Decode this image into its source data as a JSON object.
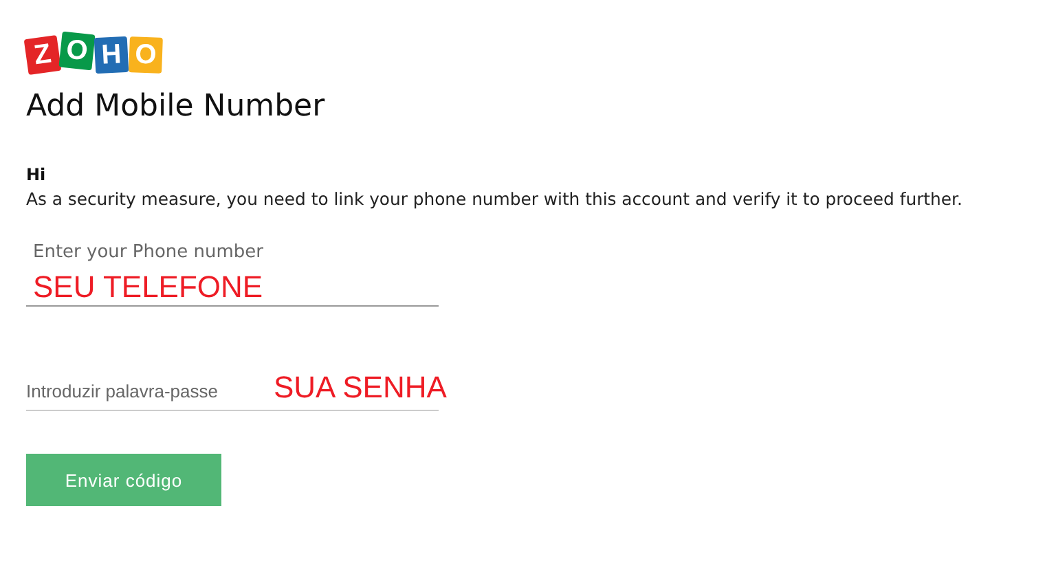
{
  "logo": {
    "letters": [
      {
        "char": "Z",
        "color": "#e42527"
      },
      {
        "char": "O",
        "color": "#089949"
      },
      {
        "char": "H",
        "color": "#226db4"
      },
      {
        "char": "O",
        "color": "#f9b21d"
      }
    ]
  },
  "title": "Add Mobile Number",
  "greeting": "Hi",
  "message": "As a security measure, you need to link your phone number with this account and verify it to proceed further.",
  "phone_field": {
    "label": "Enter your Phone number",
    "value": "SEU TELEFONE"
  },
  "password_field": {
    "placeholder": "Introduzir palavra-passe",
    "annotation": "SUA SENHA"
  },
  "button": "Enviar código"
}
